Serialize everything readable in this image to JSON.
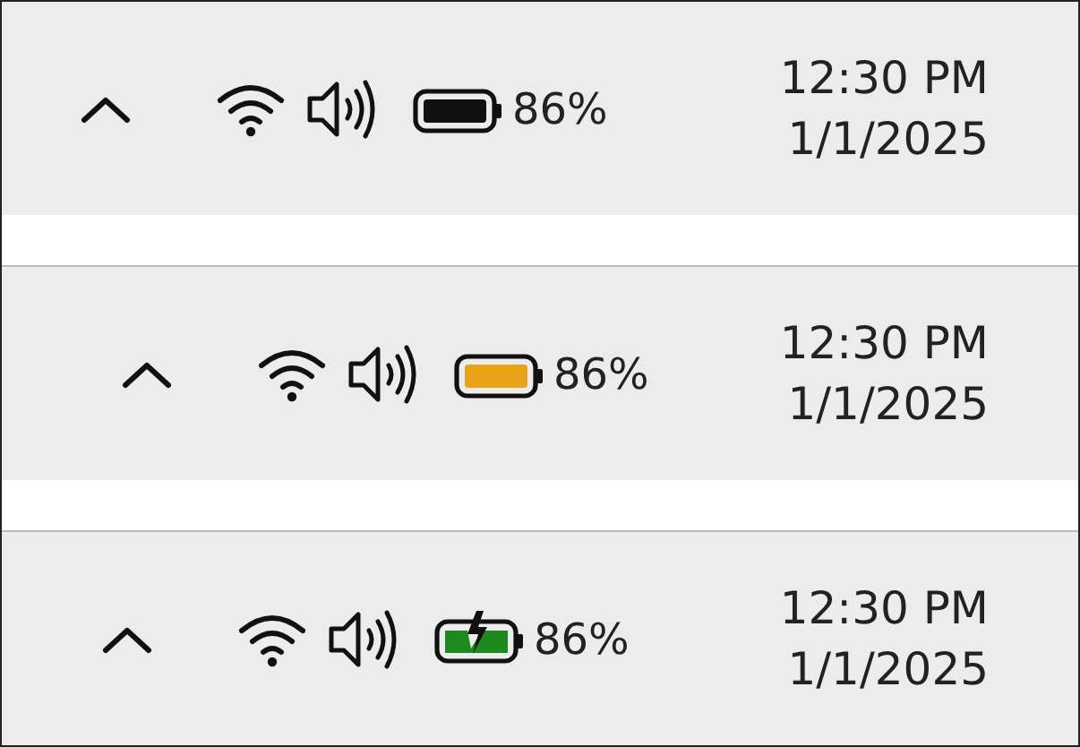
{
  "taskbars": [
    {
      "battery": {
        "kind": "normal",
        "color": "#111111",
        "percent": "86%"
      },
      "time": "12:30 PM",
      "date": "1/1/2025"
    },
    {
      "battery": {
        "kind": "saver",
        "color": "#e8a317",
        "percent": "86%"
      },
      "time": "12:30 PM",
      "date": "1/1/2025"
    },
    {
      "battery": {
        "kind": "charging",
        "color": "#1e8a1e",
        "percent": "86%"
      },
      "time": "12:30 PM",
      "date": "1/1/2025"
    }
  ]
}
